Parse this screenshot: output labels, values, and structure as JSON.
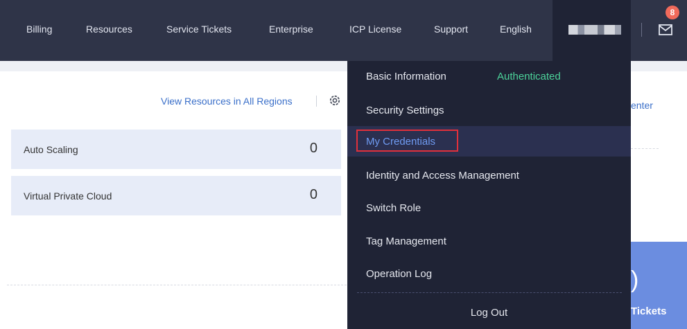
{
  "topbar": {
    "nav": [
      {
        "label": "Billing"
      },
      {
        "label": "Resources"
      },
      {
        "label": "Service Tickets"
      },
      {
        "label": "Enterprise"
      },
      {
        "label": "ICP License"
      },
      {
        "label": "Support"
      },
      {
        "label": "English"
      }
    ],
    "mail_icon": "mail-icon",
    "notification_count": "8"
  },
  "main": {
    "view_all_link": "View Resources in All Regions",
    "gear_icon": "gear-icon",
    "resources": [
      {
        "name": "Auto Scaling",
        "count": "0"
      },
      {
        "name": "Virtual Private Cloud",
        "count": "0"
      }
    ],
    "right_card": {
      "link_fragment": "enter",
      "digit_fragment": ")",
      "tickets_fragment": "Tickets"
    }
  },
  "dropdown": {
    "items": [
      {
        "label": "Basic Information",
        "status": "Authenticated"
      },
      {
        "label": "Security Settings"
      },
      {
        "label": "My Credentials"
      },
      {
        "label": "Identity and Access Management"
      },
      {
        "label": "Switch Role"
      },
      {
        "label": "Tag Management"
      },
      {
        "label": "Operation Log"
      }
    ],
    "logout_label": "Log Out"
  },
  "colors": {
    "topbar_bg": "#2f3448",
    "dropdown_bg": "#1f2335",
    "active_item_text": "#6f9bf2",
    "authenticated_text": "#4cd39a",
    "highlight_border": "#e2303b",
    "badge_bg": "#f16a5b",
    "link_text": "#3a6fc9",
    "resource_row_bg": "#e7ecf8"
  }
}
